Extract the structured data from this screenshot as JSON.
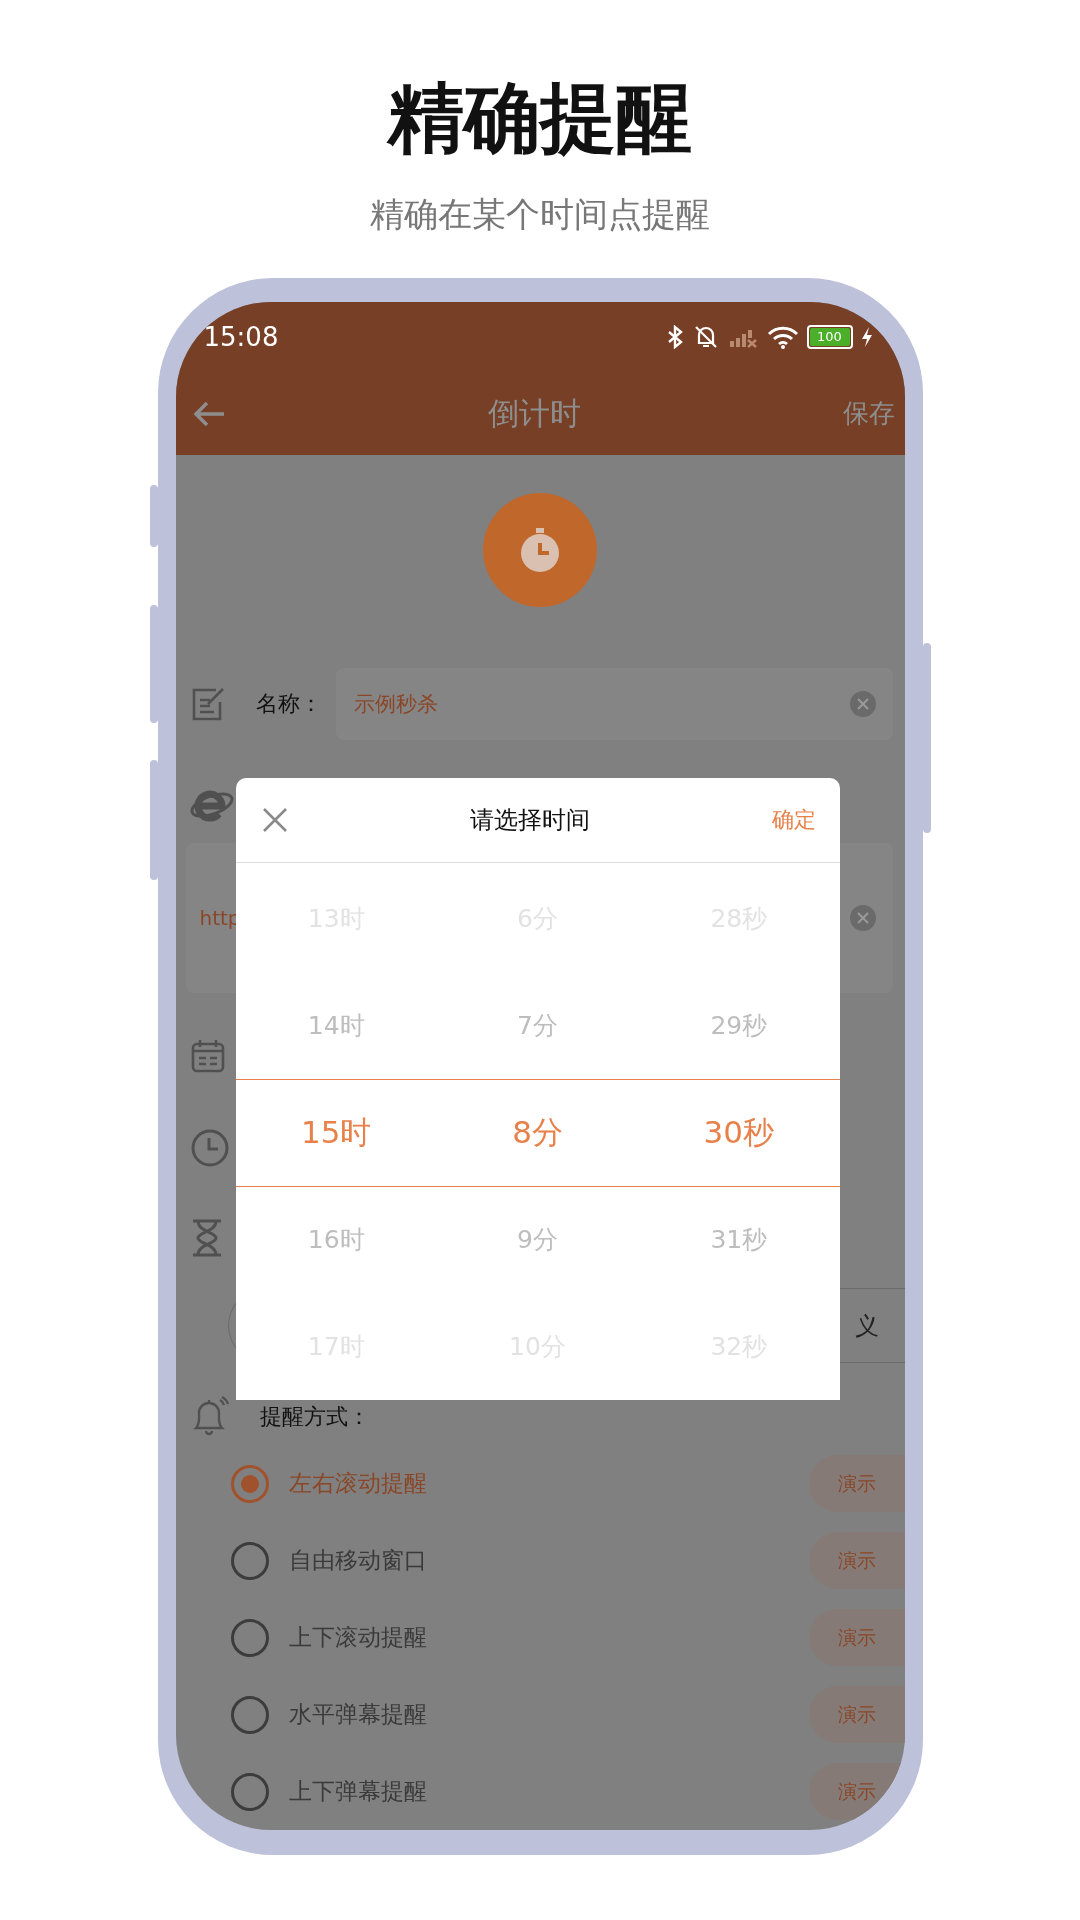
{
  "promo": {
    "title": "精确提醒",
    "subtitle": "精确在某个时间点提醒"
  },
  "status_bar": {
    "time": "15:08",
    "battery": "100"
  },
  "app_bar": {
    "title": "倒计时",
    "action": "保存"
  },
  "form": {
    "name_label": "名称：",
    "name_value": "示例秒杀",
    "url_value": "http",
    "option_button_text": "义",
    "reminder_label": "提醒方式：",
    "reminder_options": [
      {
        "label": "左右滚动提醒",
        "selected": true,
        "demo": "演示"
      },
      {
        "label": "自由移动窗口",
        "selected": false,
        "demo": "演示"
      },
      {
        "label": "上下滚动提醒",
        "selected": false,
        "demo": "演示"
      },
      {
        "label": "水平弹幕提醒",
        "selected": false,
        "demo": "演示"
      },
      {
        "label": "上下弹幕提醒",
        "selected": false,
        "demo": "演示"
      }
    ]
  },
  "dialog": {
    "title": "请选择时间",
    "confirm": "确定",
    "columns": [
      {
        "items": [
          {
            "label": "13时",
            "selected": false
          },
          {
            "label": "14时",
            "selected": false
          },
          {
            "label": "15时",
            "selected": true
          },
          {
            "label": "16时",
            "selected": false
          },
          {
            "label": "17时",
            "selected": false
          }
        ]
      },
      {
        "items": [
          {
            "label": "6分",
            "selected": false
          },
          {
            "label": "7分",
            "selected": false
          },
          {
            "label": "8分",
            "selected": true
          },
          {
            "label": "9分",
            "selected": false
          },
          {
            "label": "10分",
            "selected": false
          }
        ]
      },
      {
        "items": [
          {
            "label": "28秒",
            "selected": false
          },
          {
            "label": "29秒",
            "selected": false
          },
          {
            "label": "30秒",
            "selected": true
          },
          {
            "label": "31秒",
            "selected": false
          },
          {
            "label": "32秒",
            "selected": false
          }
        ]
      }
    ]
  }
}
